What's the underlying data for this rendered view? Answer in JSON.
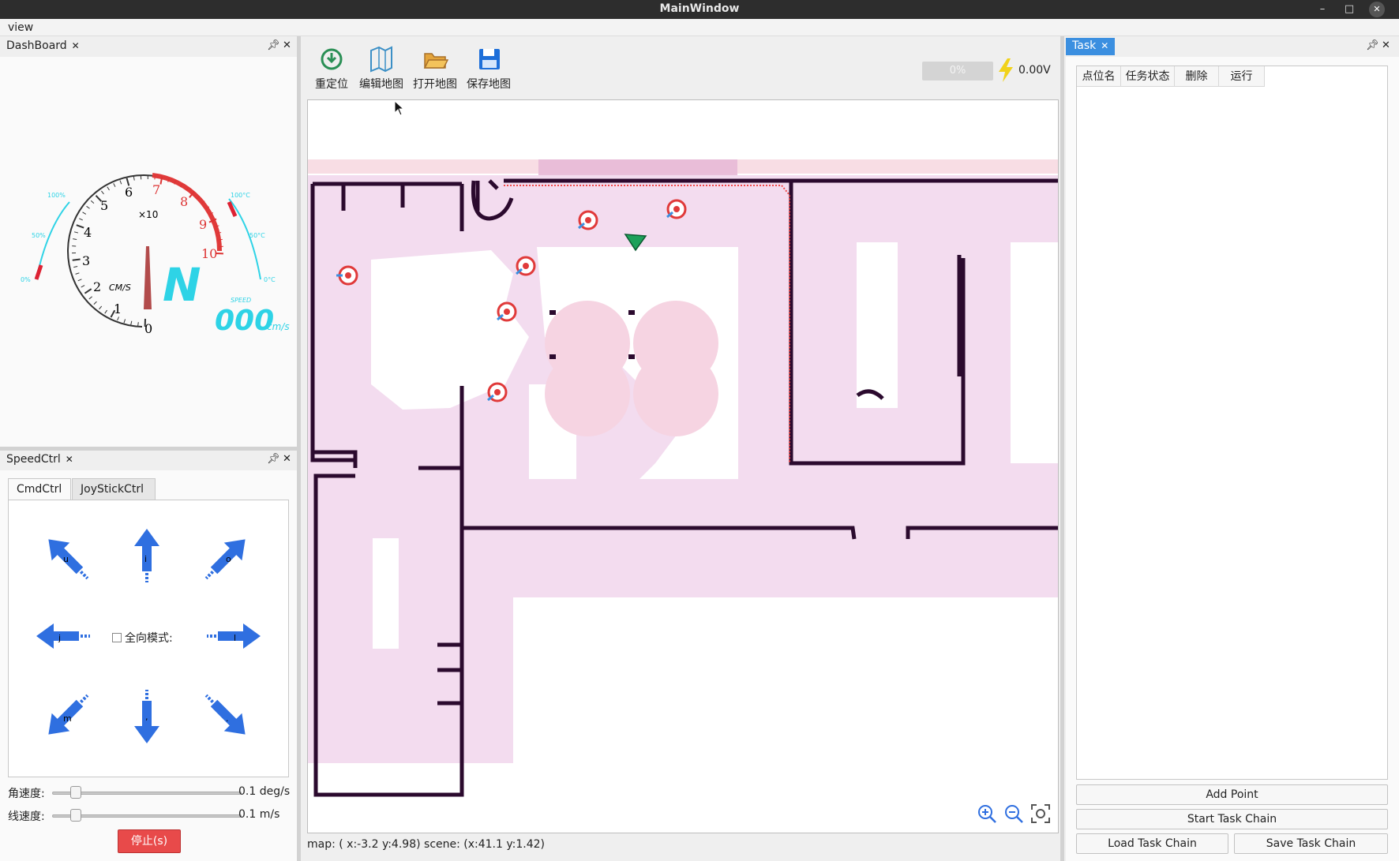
{
  "window": {
    "title": "MainWindow"
  },
  "menubar": {
    "items": [
      {
        "label": "view"
      }
    ]
  },
  "dashboard": {
    "tab_label": "DashBoard",
    "speed_unit_label": "CM/S",
    "multiplier_label": "×10",
    "dial_ticks": [
      "0",
      "1",
      "2",
      "3",
      "4",
      "5",
      "6",
      "7",
      "8",
      "9",
      "10"
    ],
    "heading": "N",
    "speed_caption": "SPEED",
    "speed_value": "000",
    "speed_suffix": "cm/s",
    "left_gauge_ticks": [
      "100%",
      "50%",
      "0%"
    ],
    "right_gauge_ticks": [
      "100°C",
      "50°C",
      "0°C"
    ],
    "colors": {
      "accent_cyan": "#2ed3e6",
      "needle": "#b24b4b",
      "redline": "#e03a3a"
    }
  },
  "speedctrl": {
    "tab_label": "SpeedCtrl",
    "tabs": [
      {
        "label": "CmdCtrl"
      },
      {
        "label": "JoyStickCtrl"
      }
    ],
    "arrow_keys": [
      "u",
      "i",
      "o",
      "j",
      "l",
      "m",
      ",",
      "."
    ],
    "omni_label": "全向模式:",
    "angular": {
      "label": "角速度:",
      "value_text": "0.1 deg/s"
    },
    "linear": {
      "label": "线速度:",
      "value_text": "0.1 m/s"
    },
    "stop_label": "停止(s)"
  },
  "toolbar": {
    "items": [
      {
        "label": "重定位",
        "icon": "relocate-icon"
      },
      {
        "label": "编辑地图",
        "icon": "edit-map-icon"
      },
      {
        "label": "打开地图",
        "icon": "open-folder-icon"
      },
      {
        "label": "保存地图",
        "icon": "save-disk-icon"
      }
    ],
    "battery_text": "0%",
    "voltage_text": "0.00V"
  },
  "status": {
    "text": "map: ( x:-3.2 y:4.98)   scene:  (x:41.1 y:1.42)"
  },
  "task": {
    "tab_label": "Task",
    "columns": [
      "点位名",
      "任务状态",
      "删除",
      "运行"
    ],
    "buttons": {
      "add_point": "Add Point",
      "start_chain": "Start Task Chain",
      "load_chain": "Load Task Chain",
      "save_chain": "Save Task Chain"
    }
  }
}
